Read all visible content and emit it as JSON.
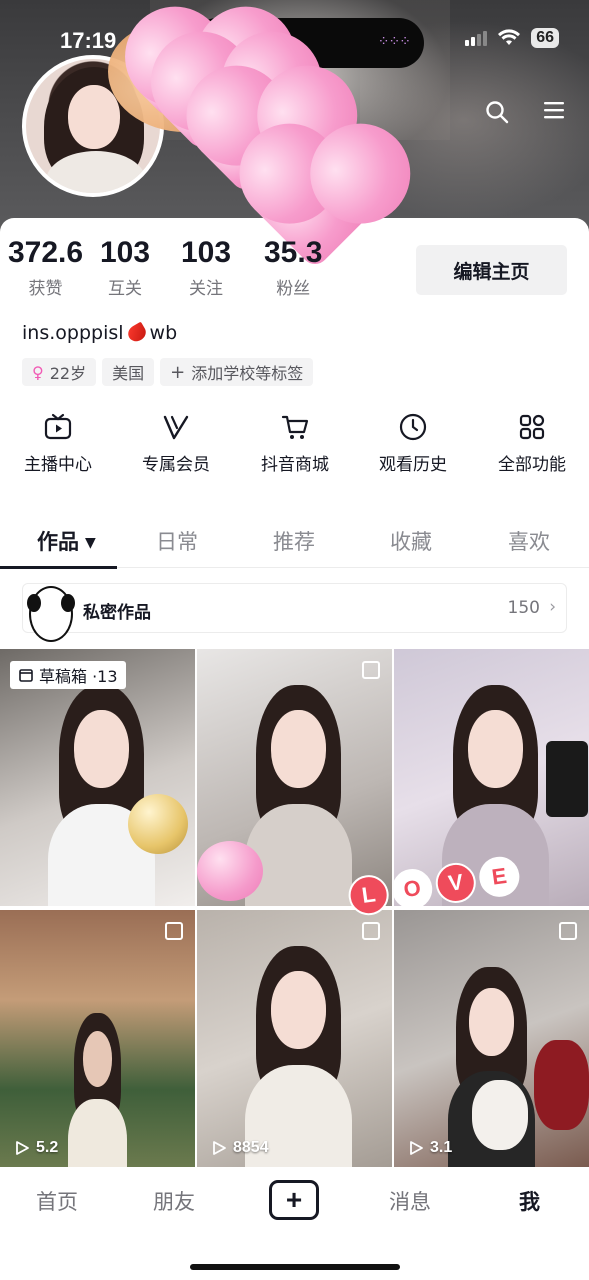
{
  "status_bar": {
    "time": "17:19",
    "battery": "66"
  },
  "profile": {
    "bio": "ins.opppisl",
    "bio_suffix": "wb",
    "edit_label": "编辑主页"
  },
  "stats": [
    {
      "value": "372.6",
      "label": "获赞"
    },
    {
      "value": "103",
      "label": "互关"
    },
    {
      "value": "103",
      "label": "关注"
    },
    {
      "value": "35.3",
      "label": "粉丝"
    }
  ],
  "tags": {
    "age": "22岁",
    "region": "美国",
    "add_school": "添加学校等标签"
  },
  "services": [
    {
      "label": "主播中心",
      "icon": "tv-icon"
    },
    {
      "label": "专属会员",
      "icon": "vip-v-icon"
    },
    {
      "label": "抖音商城",
      "icon": "cart-icon"
    },
    {
      "label": "观看历史",
      "icon": "clock-icon"
    },
    {
      "label": "全部功能",
      "icon": "apps-grid-icon"
    }
  ],
  "tabs": [
    "作品",
    "日常",
    "推荐",
    "收藏",
    "喜欢"
  ],
  "private_works": {
    "label": "私密作品",
    "count": "150"
  },
  "grid": {
    "drafts_label": "草稿箱 ·13",
    "sticker_text": "LOVE",
    "plays": [
      "5.2",
      "8854",
      "3.1"
    ]
  },
  "bottom_nav": {
    "home": "首页",
    "friends": "朋友",
    "messages": "消息",
    "me": "我"
  },
  "colors": {
    "accent_text": "#161823",
    "muted": "#75757b",
    "sticker": "#ef4b5b"
  }
}
